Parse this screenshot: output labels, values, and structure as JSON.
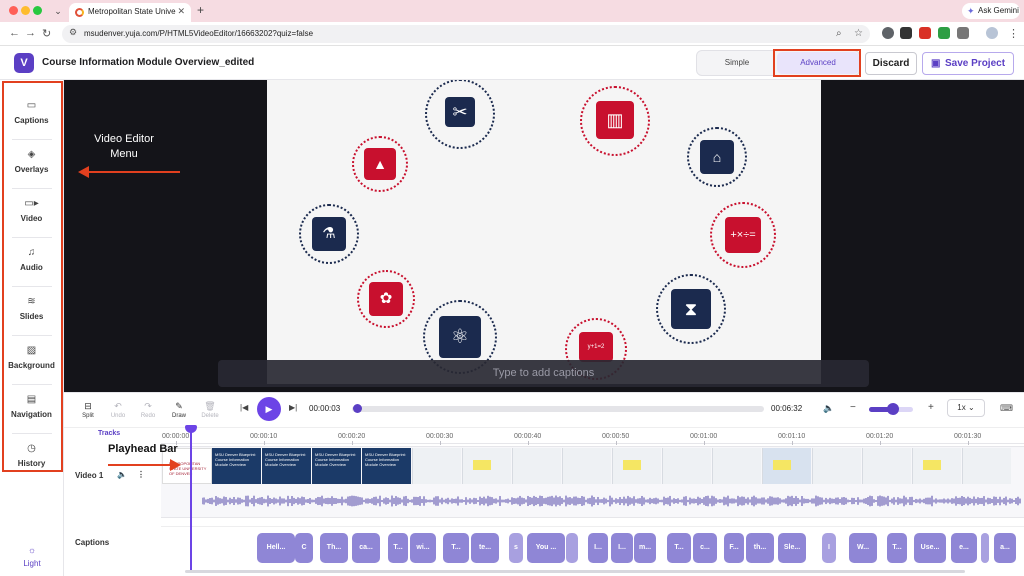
{
  "browser": {
    "tab_title": "Metropolitan State University",
    "url": "msudenver.yuja.com/P/HTML5VideoEditor/16663202?quiz=false",
    "ask_gemini": "Ask Gemini"
  },
  "app": {
    "logo_letter": "V",
    "project_title": "Course Information Module Overview_edited",
    "mode_simple": "Simple",
    "mode_advanced": "Advanced",
    "discard_label": "Discard",
    "save_label": "Save Project"
  },
  "sidebar": {
    "items": [
      {
        "label": "Captions",
        "icon": "captions-icon"
      },
      {
        "label": "Overlays",
        "icon": "overlays-icon"
      },
      {
        "label": "Video",
        "icon": "video-camera-icon"
      },
      {
        "label": "Audio",
        "icon": "music-note-icon"
      },
      {
        "label": "Slides",
        "icon": "slides-stack-icon"
      },
      {
        "label": "Background",
        "icon": "image-icon"
      },
      {
        "label": "Navigation",
        "icon": "navigation-layout-icon"
      },
      {
        "label": "History",
        "icon": "history-clock-icon"
      }
    ],
    "theme_label": "Light"
  },
  "annotations": {
    "menu_note": "Video Editor Menu",
    "playhead_note": "Playhead Bar"
  },
  "preview": {
    "caption_placeholder": "Type to add captions",
    "formula_text": "y+1=2"
  },
  "toolbar": {
    "split": "Split",
    "undo": "Undo",
    "redo": "Redo",
    "draw": "Draw",
    "delete": "Delete",
    "current_time": "00:00:03",
    "total_time": "00:06:32",
    "speed": "1x",
    "progress_fraction": 0.008,
    "zoom_fraction": 0.55
  },
  "timeline": {
    "tracks_label": "Tracks",
    "ticks": [
      "00:00:00",
      "00:00:10",
      "00:00:20",
      "00:00:30",
      "00:00:40",
      "00:00:50",
      "00:01:00",
      "00:01:10",
      "00:01:20",
      "00:01:30"
    ],
    "video_track_label": "Video 1",
    "captions_track_label": "Captions",
    "thumb_title": "MSU Denver Blueprint: Course Information Module Overview",
    "thumb_logo": "METROPOLITAN STATE UNIVERSITY OF DENVER",
    "caption_chips": [
      "Hell...",
      "C",
      "Th...",
      "ca...",
      "T...",
      "wi...",
      "T...",
      "te...",
      "s",
      "You ...",
      "",
      "I...",
      "I...",
      "m...",
      "T...",
      "c...",
      "F...",
      "th...",
      "Sle...",
      "I",
      "W...",
      "T...",
      "Use...",
      "e...",
      "",
      "a..."
    ]
  },
  "colors": {
    "accent": "#5b3fc4",
    "highlight": "#e2401f",
    "red_tile": "#c8102e",
    "navy_tile": "#1b2a4e"
  }
}
